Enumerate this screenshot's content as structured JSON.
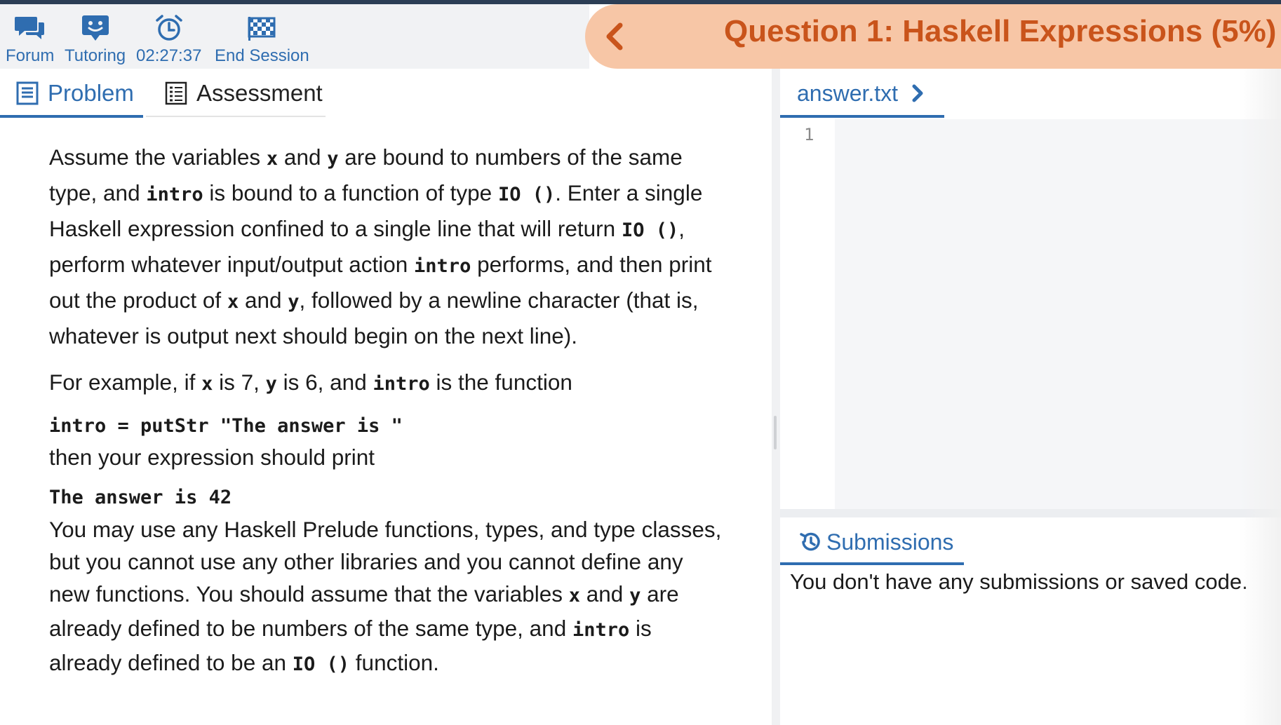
{
  "toolbar": {
    "forum": "Forum",
    "tutoring": "Tutoring",
    "timer": "02:27:37",
    "end_session": "End Session"
  },
  "question": {
    "title": "Question 1: Haskell Expressions (5%)"
  },
  "tabs": {
    "problem": "Problem",
    "assessment": "Assessment"
  },
  "problem": {
    "p1": {
      "t1": "Assume the variables ",
      "c1": "x",
      "t2": " and ",
      "c2": "y",
      "t3": " are bound to numbers of the same type, and ",
      "c3": "intro",
      "t4": " is bound to a function of type ",
      "c4": "IO ()",
      "t5": ". Enter a single Haskell expression confined to a single line that will return ",
      "c5": "IO ()",
      "t6": ", perform whatever input/output action ",
      "c6": "intro",
      "t7": " performs, and then print out the product of ",
      "c7": "x",
      "t8": " and ",
      "c8": "y",
      "t9": ", followed by a newline character (that is, whatever is output next should begin on the next line)."
    },
    "p2": {
      "t1": "For example, if ",
      "c1": "x",
      "t2": " is 7, ",
      "c2": "y",
      "t3": " is 6, and ",
      "c3": "intro",
      "t4": " is the function"
    },
    "code1": "intro = putStr \"The answer is \"",
    "p3": "then your expression should print",
    "code2": "The answer is 42",
    "p4": {
      "t1": "You may use any Haskell Prelude functions, types, and type classes, but you cannot use any other libraries and you cannot define any new functions. You should assume that the variables ",
      "c1": "x",
      "t2": " and ",
      "c2": "y",
      "t3": " are already defined to be numbers of the same type, and ",
      "c3": "intro",
      "t4": " is already defined to be an ",
      "c4": "IO ()",
      "t5": " function."
    }
  },
  "editor": {
    "file_name": "answer.txt",
    "line_number": "1",
    "content": ""
  },
  "submissions": {
    "label": "Submissions",
    "empty_message": "You don't have any submissions or saved code."
  },
  "colors": {
    "accent": "#2f6db0",
    "banner_bg": "#f7c6a6",
    "banner_text": "#c9541b",
    "top_bar": "#2c3e55"
  },
  "icons": {
    "forum": "speech-bubbles-icon",
    "tutoring": "tutor-chat-icon",
    "timer": "alarm-clock-icon",
    "end_session": "checkered-flag-icon",
    "back": "chevron-left-icon",
    "problem": "document-icon",
    "assessment": "checklist-icon",
    "file_next": "chevron-right-icon",
    "submissions": "history-icon"
  }
}
